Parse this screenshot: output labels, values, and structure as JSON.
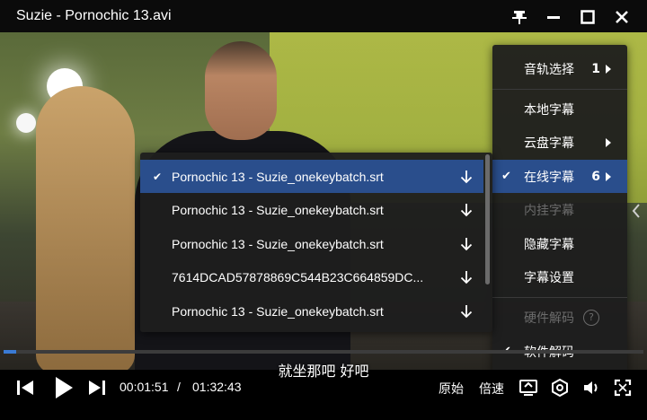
{
  "window": {
    "title": "Suzie - Pornochic 13.avi"
  },
  "menu": {
    "items": [
      {
        "label": "音轨选择",
        "count": "1",
        "has_arrow": true,
        "checked": false,
        "disabled": false
      },
      {
        "label": "本地字幕",
        "count": "",
        "has_arrow": false,
        "checked": false,
        "disabled": false
      },
      {
        "label": "云盘字幕",
        "count": "",
        "has_arrow": true,
        "checked": false,
        "disabled": false
      },
      {
        "label": "在线字幕",
        "count": "6",
        "has_arrow": true,
        "checked": true,
        "disabled": false,
        "active": true
      },
      {
        "label": "内挂字幕",
        "count": "",
        "has_arrow": false,
        "checked": false,
        "disabled": true
      },
      {
        "label": "隐藏字幕",
        "count": "",
        "has_arrow": false,
        "checked": false,
        "disabled": false
      },
      {
        "label": "字幕设置",
        "count": "",
        "has_arrow": false,
        "checked": false,
        "disabled": false
      },
      {
        "label": "硬件解码",
        "count": "",
        "has_arrow": false,
        "checked": false,
        "disabled": true,
        "help": "?"
      },
      {
        "label": "软件解码",
        "count": "",
        "has_arrow": false,
        "checked": true,
        "disabled": false
      }
    ],
    "check_glyph": "✔"
  },
  "submenu": {
    "items": [
      {
        "label": "Pornochic 13 - Suzie_onekeybatch.srt",
        "checked": true
      },
      {
        "label": "Pornochic 13 - Suzie_onekeybatch.srt",
        "checked": false
      },
      {
        "label": "Pornochic 13 - Suzie_onekeybatch.srt",
        "checked": false
      },
      {
        "label": "7614DCAD57878869C544B23C664859DC...",
        "checked": false
      },
      {
        "label": "Pornochic 13 - Suzie_onekeybatch.srt",
        "checked": false
      }
    ]
  },
  "player": {
    "subtitle": "就坐那吧  好吧",
    "current_time": "00:01:51",
    "separator": "/",
    "total_time": "01:32:43",
    "progress_fraction": 0.02,
    "original_label": "原始",
    "speed_label": "倍速"
  },
  "colors": {
    "accent": "#2a4e8c",
    "progress": "#3a7bd5"
  }
}
